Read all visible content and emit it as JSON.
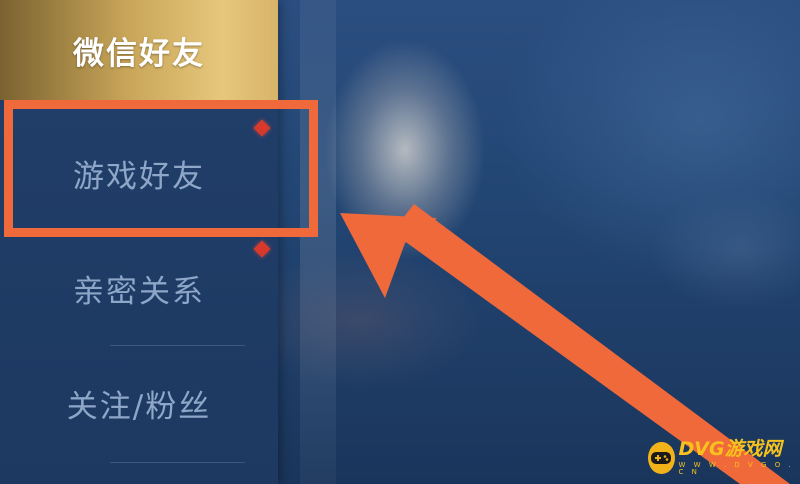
{
  "menu": {
    "items": [
      {
        "label": "微信好友",
        "active": true
      },
      {
        "label": "游戏好友",
        "active": false,
        "badge": true
      },
      {
        "label": "亲密关系",
        "active": false,
        "badge": true
      },
      {
        "label": "关注/粉丝",
        "active": false
      }
    ]
  },
  "annotation": {
    "color": "#f0693a",
    "target": "游戏好友"
  },
  "watermark": {
    "brand": "DVG游戏网",
    "url": "W W W . D V G O . C N",
    "icon": "gamepad-icon",
    "color": "#f7c21d"
  },
  "colors": {
    "active_gold": "#e6c77b",
    "menu_text": "#8ea6c7",
    "badge_red": "#d8392b"
  }
}
